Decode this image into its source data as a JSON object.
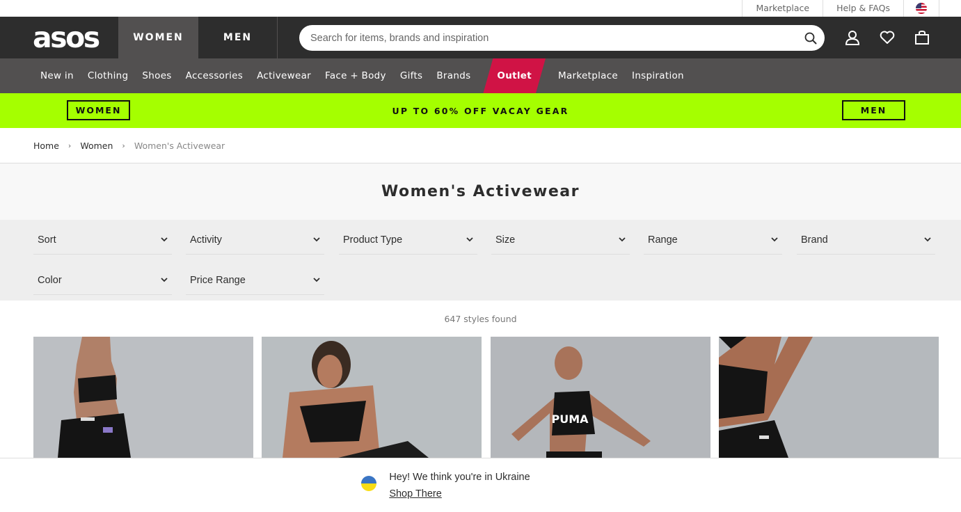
{
  "utility": {
    "links": [
      "Marketplace",
      "Help & FAQs"
    ],
    "country_flag": "us-flag-icon"
  },
  "header": {
    "logo": "asos",
    "tabs": [
      "WOMEN",
      "MEN"
    ],
    "search_placeholder": "Search for items, brands and inspiration",
    "icons": [
      "account-icon",
      "saved-items-heart-icon",
      "bag-icon"
    ]
  },
  "catnav": {
    "items": [
      "New in",
      "Clothing",
      "Shoes",
      "Accessories",
      "Activewear",
      "Face + Body",
      "Gifts",
      "Brands",
      "Outlet",
      "Marketplace",
      "Inspiration"
    ]
  },
  "promo": {
    "left_button": "WOMEN",
    "text": "UP TO 60% OFF VACAY GEAR",
    "right_button": "MEN",
    "color": "#a5ff00"
  },
  "breadcrumb": [
    "Home",
    "Women",
    "Women's Activewear"
  ],
  "page_title": "Women's Activewear",
  "filters": [
    "Sort",
    "Activity",
    "Product Type",
    "Size",
    "Range",
    "Brand",
    "Color",
    "Price Range"
  ],
  "results_count": "647 styles found",
  "products": [
    {
      "image": "woman-black-sports-bra-back-view"
    },
    {
      "image": "woman-black-sports-bra-bending"
    },
    {
      "image": "woman-puma-crop-top-dancing",
      "print": "PUMA"
    },
    {
      "image": "woman-black-crop-top-arm-raised"
    }
  ],
  "geo_banner": {
    "message": "Hey! We think you're in Ukraine",
    "link": "Shop There",
    "flag": "ukraine-flag-icon"
  },
  "colors": {
    "header": "#2d2d2d",
    "nav": "#525050",
    "outlet": "#d01345",
    "promo": "#a5ff00"
  }
}
